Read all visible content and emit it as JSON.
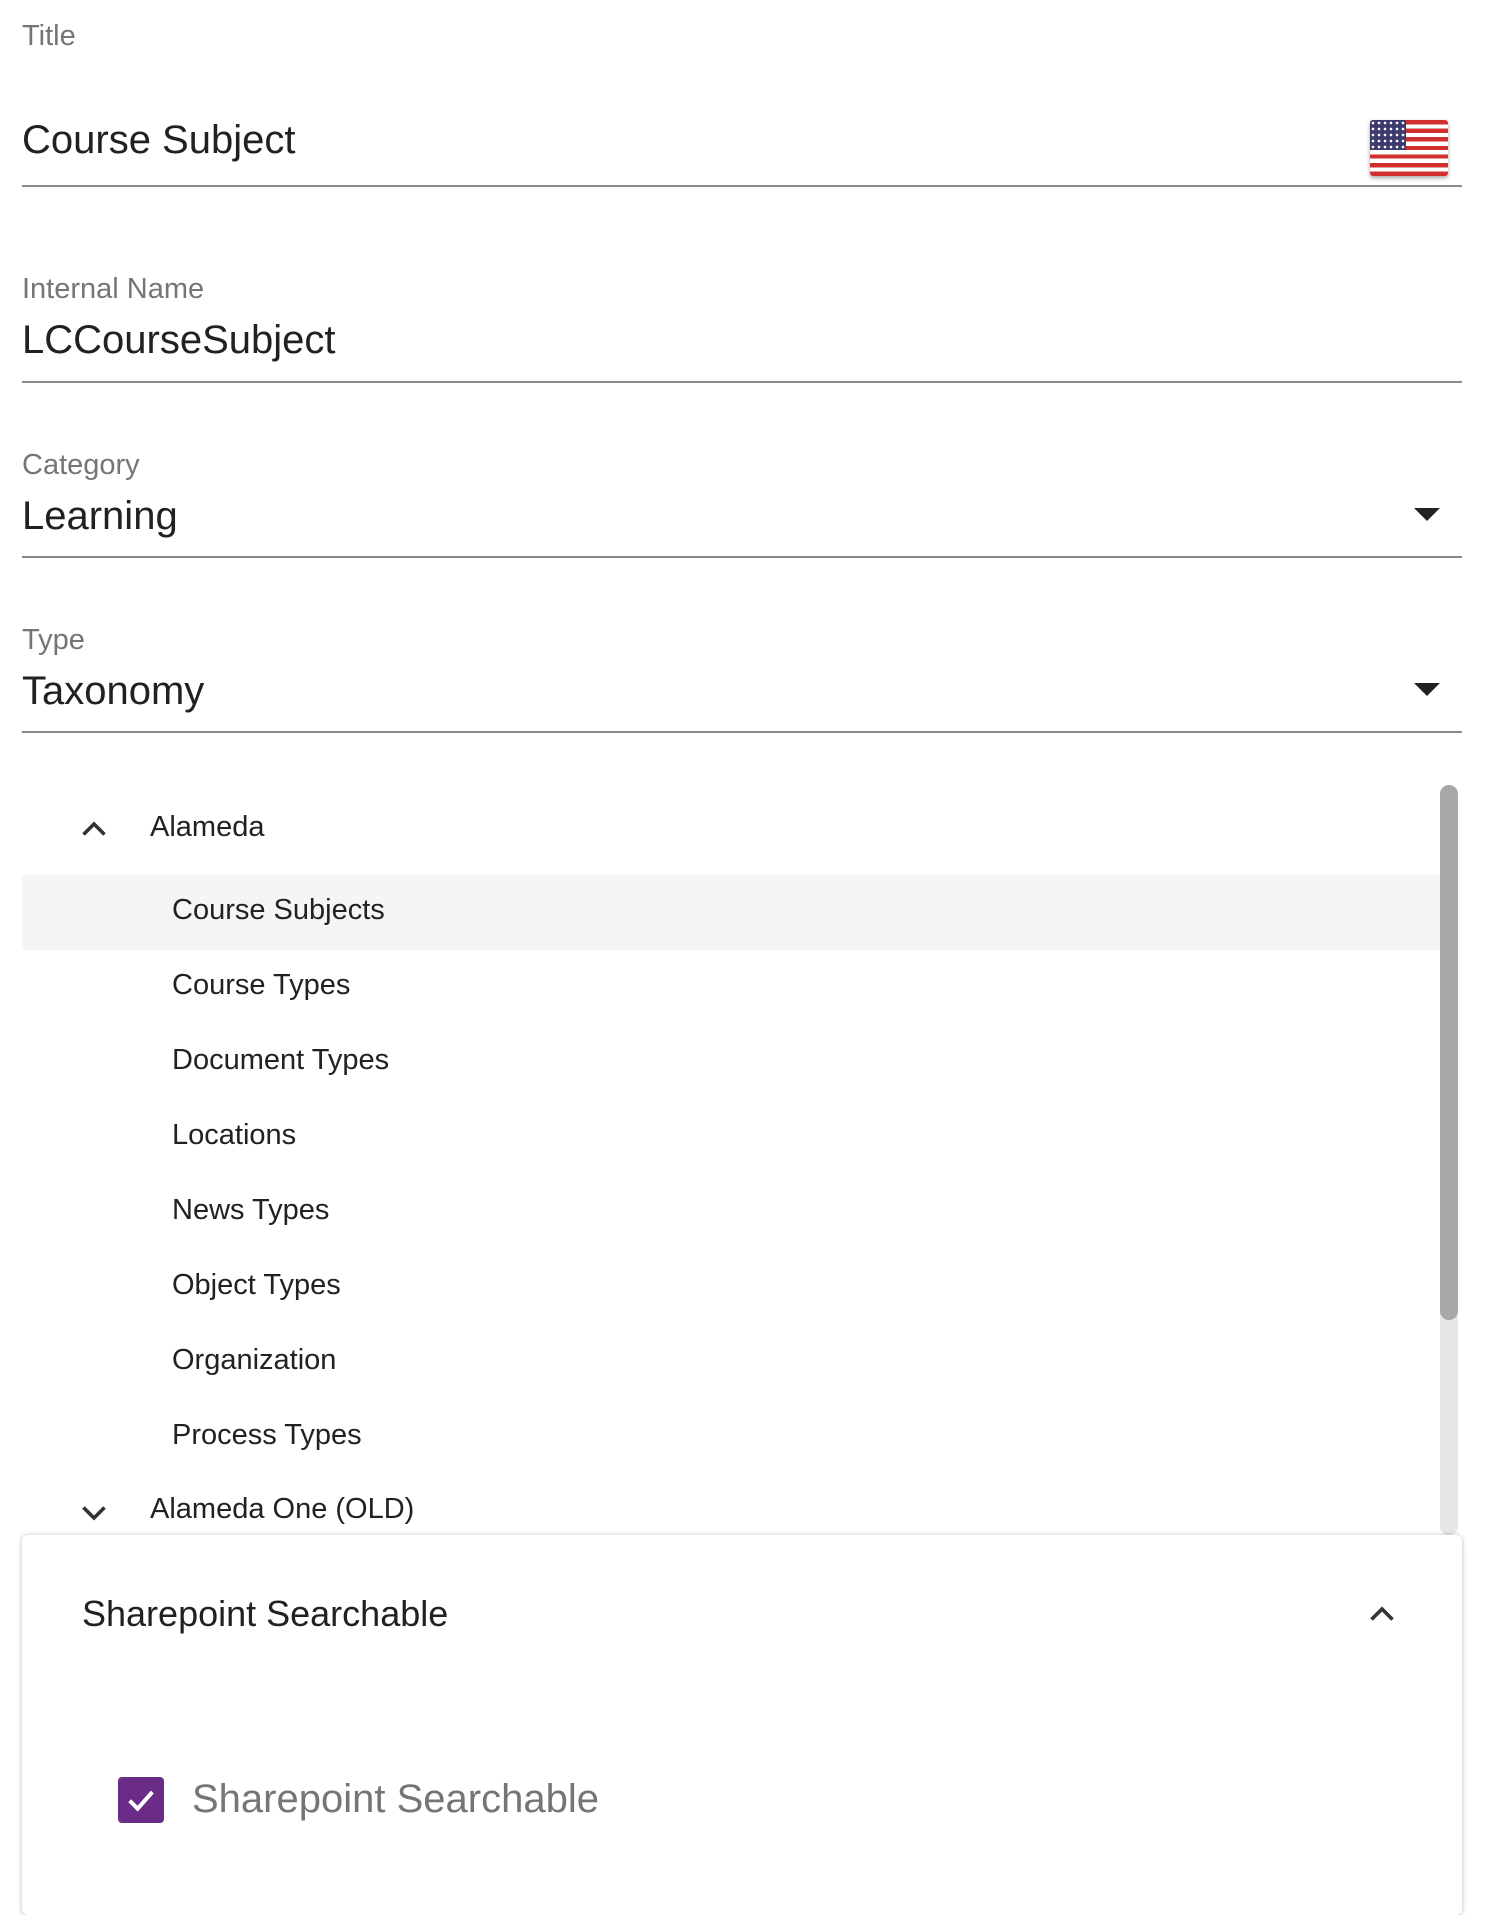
{
  "title_field": {
    "label": "Title",
    "value": "Course Subject",
    "flag_icon": "us-flag-icon"
  },
  "internal_name_field": {
    "label": "Internal Name",
    "value": "LCCourseSubject"
  },
  "category_field": {
    "label": "Category",
    "value": "Learning"
  },
  "type_field": {
    "label": "Type",
    "value": "Taxonomy"
  },
  "tree": {
    "groups": [
      {
        "label": "Alameda",
        "expanded": true,
        "children": [
          {
            "label": "Course Subjects",
            "selected": true
          },
          {
            "label": "Course Types"
          },
          {
            "label": "Document Types"
          },
          {
            "label": "Locations"
          },
          {
            "label": "News Types"
          },
          {
            "label": "Object Types"
          },
          {
            "label": "Organization"
          },
          {
            "label": "Process Types"
          }
        ]
      },
      {
        "label": "Alameda One (OLD)",
        "expanded": false
      }
    ]
  },
  "sharepoint_panel": {
    "title": "Sharepoint Searchable",
    "checkbox_label": "Sharepoint Searchable",
    "checked": true,
    "accent_color": "#6a2c86"
  }
}
